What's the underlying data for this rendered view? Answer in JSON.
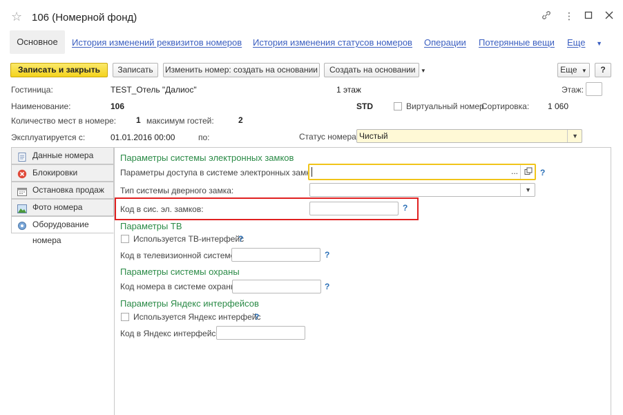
{
  "window": {
    "title": "106 (Номерной фонд)"
  },
  "nav": {
    "main": "Основное",
    "links": [
      "История изменений реквизитов номеров",
      "История изменения статусов номеров",
      "Операции",
      "Потерянные вещи"
    ],
    "more": "Еще"
  },
  "toolbar": {
    "save_close": "Записать и закрыть",
    "save": "Записать",
    "change_number": "Изменить номер: создать на основании",
    "create_based": "Создать на основании",
    "more": "Еще",
    "help": "?"
  },
  "header": {
    "hotel_label": "Гостиница:",
    "hotel_value": "TEST_Отель \"Далиос\"",
    "floor_value": "1 этаж",
    "floor_label": "Этаж:",
    "name_label": "Наименование:",
    "name_value": "106",
    "std_value": "STD",
    "virtual_label": "Виртуальный номер",
    "sort_label": "Сортировка:",
    "sort_value": "1 060",
    "places_label": "Количество мест в номере:",
    "places_value": "1",
    "max_guests_label": "максимум гостей:",
    "max_guests_value": "2",
    "used_from_label": "Эксплуатируется с:",
    "used_from_value": "01.01.2016 00:00",
    "to_label": "по:",
    "status_label": "Статус номера:",
    "status_value": "Чистый"
  },
  "tabs": [
    {
      "label": "Данные номера",
      "icon": "document-icon"
    },
    {
      "label": "Блокировки",
      "icon": "block-icon"
    },
    {
      "label": "Остановка продаж",
      "icon": "calendar-icon"
    },
    {
      "label": "Фото номера",
      "icon": "photo-icon"
    },
    {
      "label": "Оборудование номера",
      "icon": "equipment-icon"
    }
  ],
  "panel": {
    "locks_title": "Параметры системы электронных замков",
    "access_label": "Параметры доступа в системе электронных замков:",
    "access_dots": "...",
    "lock_type_label": "Тип системы дверного замка:",
    "lock_code_label": "Код в сис. эл. замков:",
    "tv_title": "Параметры ТВ",
    "tv_used_label": "Используется ТВ-интерфейс",
    "tv_code_label": "Код в телевизионной системе:",
    "security_title": "Параметры системы охраны",
    "security_code_label": "Код номера в системе охраны:",
    "yandex_title": "Параметры Яндекс интерфейсов",
    "yandex_used_label": "Используется Яндекс интерфейс",
    "yandex_code_label": "Код в Яндекс интерфейсе:",
    "help": "?"
  },
  "colors": {
    "link": "#3a5ec0",
    "section": "#2a8a46",
    "primary_button": "#f4d31e",
    "highlight": "#e02020",
    "status_field": "#fff9d6",
    "focus_border": "#f0c419"
  }
}
